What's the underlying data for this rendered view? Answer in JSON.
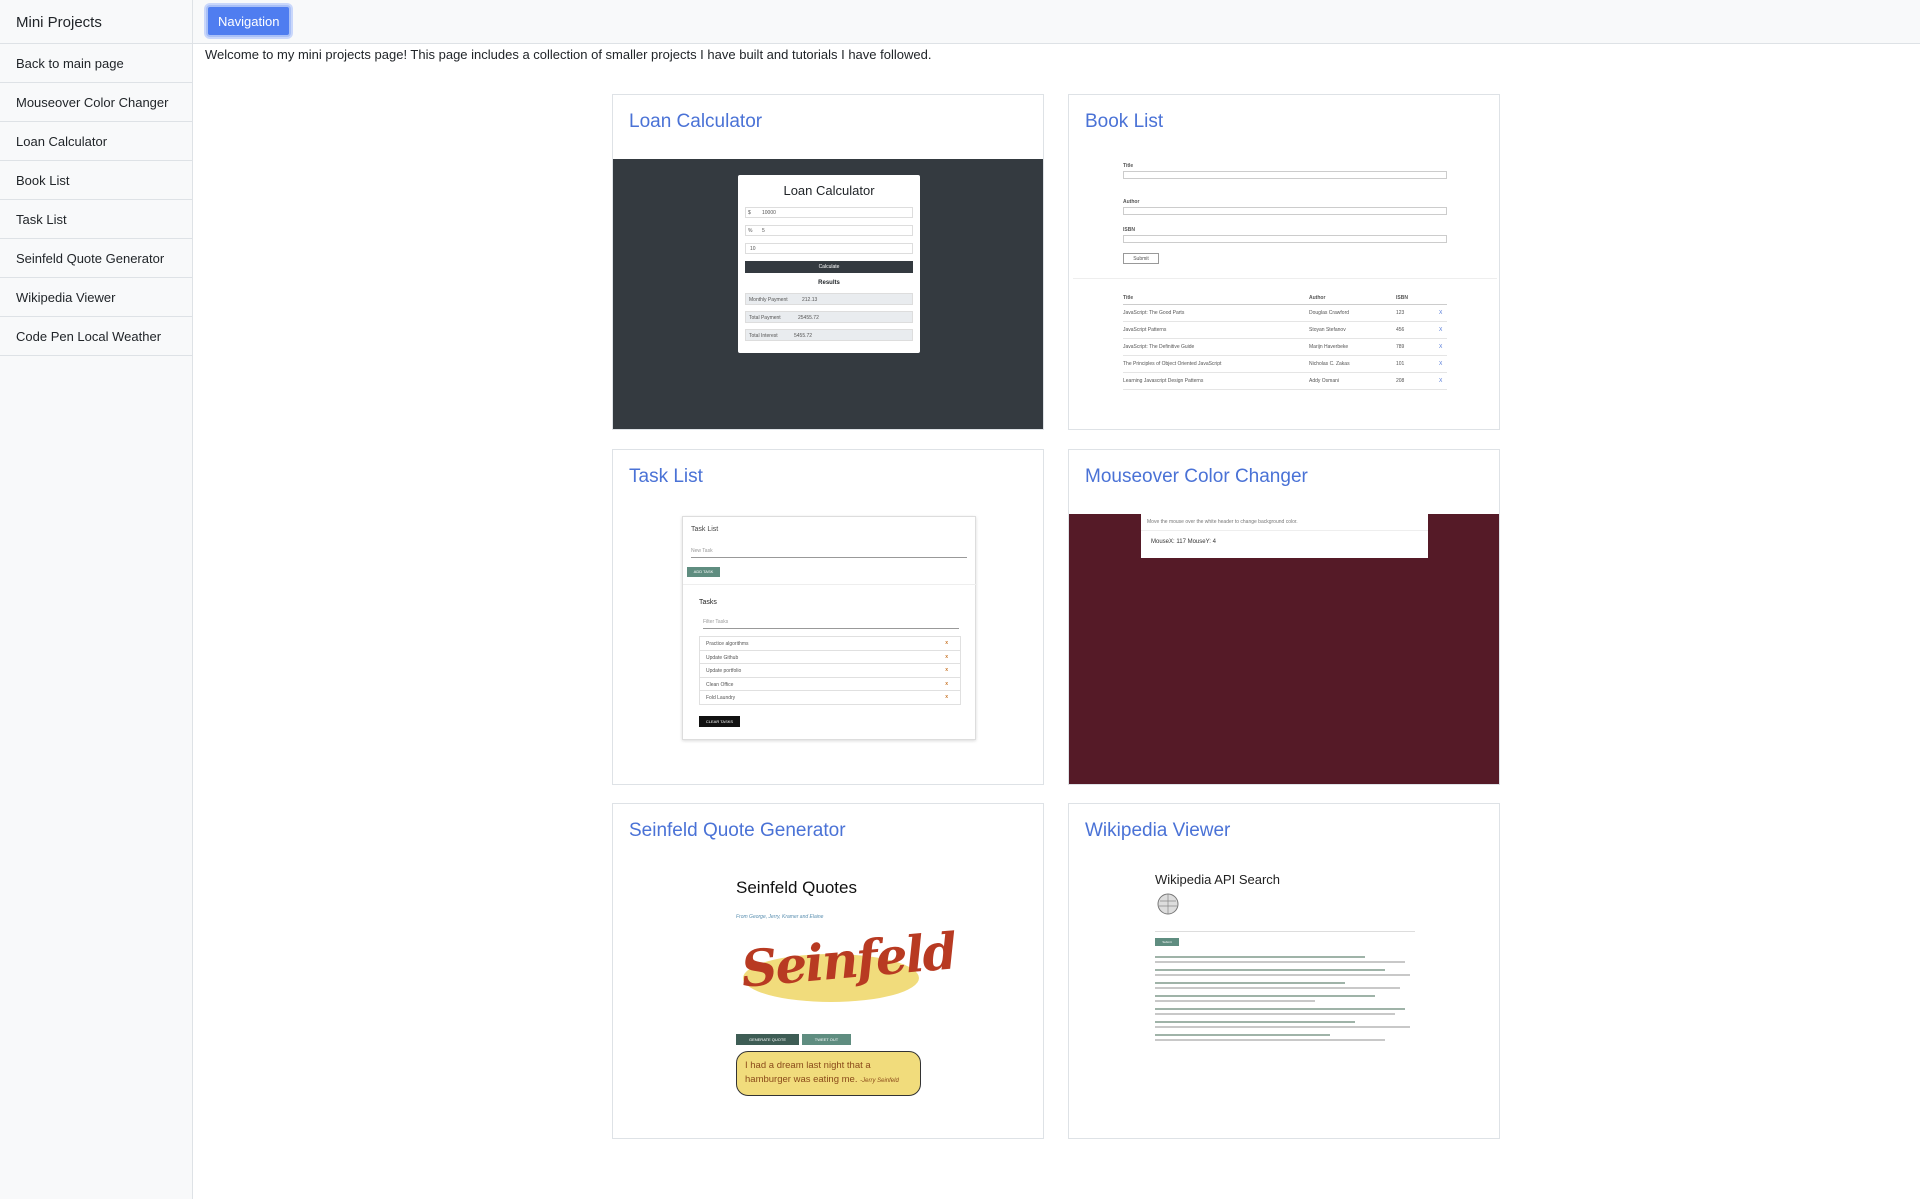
{
  "sidebar": {
    "title": "Mini Projects",
    "items": [
      {
        "label": "Back to main page"
      },
      {
        "label": "Mouseover Color Changer"
      },
      {
        "label": "Loan Calculator"
      },
      {
        "label": "Book List"
      },
      {
        "label": "Task List"
      },
      {
        "label": "Seinfeld Quote Generator"
      },
      {
        "label": "Wikipedia Viewer"
      },
      {
        "label": "Code Pen Local Weather"
      }
    ]
  },
  "topbar": {
    "nav_button": "Navigation"
  },
  "intro": "Welcome to my mini projects page! This page includes a collection of smaller projects I have built and tutorials I have followed.",
  "cards": [
    {
      "title": "Loan Calculator"
    },
    {
      "title": "Book List"
    },
    {
      "title": "Task List"
    },
    {
      "title": "Mouseover Color Changer"
    },
    {
      "title": "Seinfeld Quote Generator"
    },
    {
      "title": "Wikipedia Viewer"
    }
  ],
  "previews": {
    "loan": {
      "heading": "Loan Calculator",
      "amount_prefix": "$",
      "amount": "10000",
      "interest_prefix": "%",
      "interest": "5",
      "years": "10",
      "button": "Calculate",
      "results_heading": "Results",
      "rows": [
        {
          "label": "Monthly Payment",
          "value": "212.13"
        },
        {
          "label": "Total Payment",
          "value": "25455.72"
        },
        {
          "label": "Total Interest",
          "value": "5455.72"
        }
      ]
    },
    "book": {
      "title_label": "Title",
      "author_label": "Author",
      "isbn_label": "ISBN",
      "submit": "Submit",
      "columns": [
        "Title",
        "Author",
        "ISBN"
      ],
      "rows": [
        {
          "title": "JavaScript: The Good Parts",
          "author": "Douglas Crawford",
          "isbn": "123"
        },
        {
          "title": "JavaScript Patterns",
          "author": "Stoyan Stefanov",
          "isbn": "456"
        },
        {
          "title": "JavaScript: The Definitive Guide",
          "author": "Marijn Haverbeke",
          "isbn": "789"
        },
        {
          "title": "The Principles of Object Oriented JavaScript",
          "author": "Nicholas C. Zakas",
          "isbn": "101"
        },
        {
          "title": "Learning Javascript Design Patterns",
          "author": "Addy Osmani",
          "isbn": "208"
        }
      ],
      "delete": "X"
    },
    "task": {
      "heading": "Task List",
      "new_task_placeholder": "New Task",
      "add_button": "ADD TASK",
      "tasks_heading": "Tasks",
      "filter_placeholder": "Filter Tasks",
      "tasks": [
        "Practice algorithms",
        "Update Github",
        "Update portfolio",
        "Clean Office",
        "Fold Laundry"
      ],
      "remove": "x",
      "clear_button": "CLEAR TASKS"
    },
    "mouse": {
      "hint": "Move the mouse over the white header to change background color.",
      "readout": "MouseX: 117 MouseY: 4",
      "bg_color": "#551a27"
    },
    "seinfeld": {
      "heading": "Seinfeld Quotes",
      "subtitle": "From George, Jerry, Kramer and Elaine",
      "logo_text": "Seinfeld",
      "generate_button": "GENERATE QUOTE",
      "tweet_button": "TWEET OUT",
      "quote": "I had a dream last night that a hamburger was eating me.",
      "author": "-Jerry Seinfeld"
    },
    "wiki": {
      "heading": "Wikipedia API Search",
      "search_button": "Submit"
    }
  },
  "colors": {
    "accent": "#4a72d6",
    "nav_button": "#4f7df0",
    "loan_bg": "#343a40"
  }
}
